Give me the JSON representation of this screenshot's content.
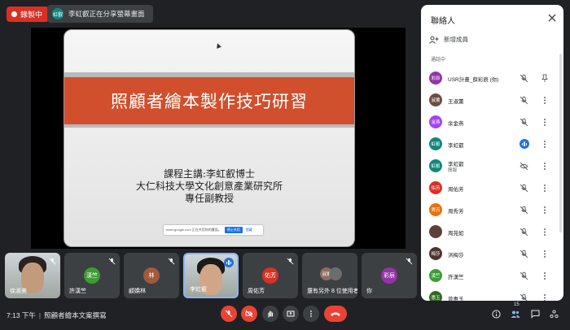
{
  "top": {
    "recording_label": "錄製中",
    "presenting_avatar": "虹叡",
    "presenting_text": "李虹叡正在分享螢幕畫面"
  },
  "slide": {
    "title": "照顧者繪本製作技巧研習",
    "lecturer_line1": "課程主講:李虹叡博士",
    "lecturer_line2": "大仁科技大學文化創意產業研究所",
    "lecturer_line3": "專任副教授",
    "meet_bar_text": "meet.google.com 正在共用你的畫面。",
    "meet_bar_stop": "停止共用",
    "meet_bar_hide": "隱藏"
  },
  "tiles": [
    {
      "name": "徐淑美",
      "avatar": "",
      "color": "#000000"
    },
    {
      "name": "許漢竺",
      "avatar": "漢竺",
      "color": "#3f9c35"
    },
    {
      "name": "顧嬌林",
      "avatar": "林",
      "color": "#a15a3c"
    },
    {
      "name": "李虹叡",
      "avatar": "",
      "color": "#000000"
    },
    {
      "name": "周佑芳",
      "avatar": "佑芳",
      "color": "#d93025"
    },
    {
      "name": "還有另外 8 位使用者",
      "avatar": "淑薰",
      "color": "#8d6e63"
    },
    {
      "name": "你",
      "avatar": "彩辰",
      "color": "#9334a6"
    }
  ],
  "bottom": {
    "time": "7:13 下午",
    "meeting_title": "照顧者繪本文案撰寫",
    "participant_count": "15"
  },
  "panel": {
    "title": "聯絡人",
    "add_member": "新增成員",
    "in_call": "通話中",
    "people": [
      {
        "avatar": "彩辰",
        "color": "#9334a6",
        "name": "USR計畫_薛彩辰 (你)",
        "sub": "",
        "state": "muted-pin"
      },
      {
        "avatar": "淑薰",
        "color": "#6d4c41",
        "name": "王淑薰",
        "sub": "",
        "state": "muted"
      },
      {
        "avatar": "金燕",
        "color": "#a142f4",
        "name": "余金燕",
        "sub": "",
        "state": "muted"
      },
      {
        "avatar": "虹叡",
        "color": "#12877e",
        "name": "李虹叡",
        "sub": "",
        "state": "speaking"
      },
      {
        "avatar": "虹叡",
        "color": "#12877e",
        "name": "李虹叡",
        "sub": "簡報",
        "state": "hidden"
      },
      {
        "avatar": "佑芳",
        "color": "#d93025",
        "name": "周佑芳",
        "sub": "",
        "state": "muted"
      },
      {
        "avatar": "秀芳",
        "color": "#e8710a",
        "name": "周秀芳",
        "sub": "",
        "state": "muted"
      },
      {
        "avatar": "",
        "color": "#5d4037",
        "name": "周苑如",
        "sub": "",
        "state": "muted"
      },
      {
        "avatar": "梅莎",
        "color": "#4e342e",
        "name": "洪梅莎",
        "sub": "",
        "state": "muted"
      },
      {
        "avatar": "漢竺",
        "color": "#3f9c35",
        "name": "許漢竺",
        "sub": "",
        "state": "muted"
      },
      {
        "avatar": "惠玉",
        "color": "#33691e",
        "name": "曾惠玉",
        "sub": "",
        "state": "muted"
      }
    ]
  }
}
